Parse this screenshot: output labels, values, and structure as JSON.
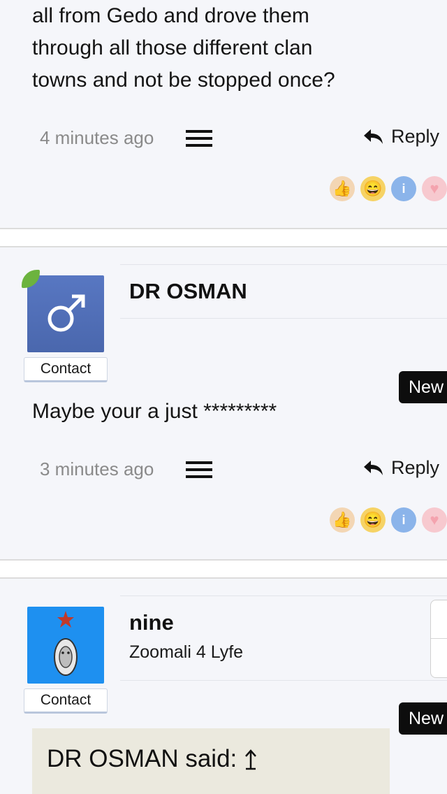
{
  "post1": {
    "text_lines": [
      "all from Gedo and drove them",
      "through all those different clan",
      "towns and not be stopped once?"
    ],
    "time": "4 minutes ago",
    "reply_label": "Reply"
  },
  "post2": {
    "username": "DR OSMAN",
    "contact_label": "Contact",
    "new_label": "New",
    "text": "Maybe your a just *********",
    "time": "3 minutes ago",
    "reply_label": "Reply"
  },
  "post3": {
    "username": "nine",
    "user_title": "Zoomali 4 Lyfe",
    "contact_label": "Contact",
    "new_label": "New",
    "quote_author_label": "DR OSMAN said:"
  },
  "reactions": [
    "thumbs-up-icon",
    "laugh-icon",
    "info-icon",
    "heart-icon"
  ],
  "colors": {
    "background": "#f5f6fa",
    "avatar_male": "#4a6db3",
    "avatar_nine": "#1e90f0",
    "online_indicator": "#6cb33e",
    "quote_background": "#ebe9de"
  }
}
